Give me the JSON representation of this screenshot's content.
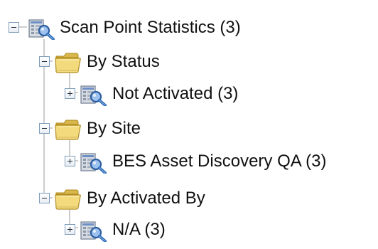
{
  "tree": {
    "root": {
      "label": "Scan Point Statistics (3)",
      "icon": "report-magnifier-icon",
      "expanded": true
    },
    "groups": [
      {
        "label": "By Status",
        "icon": "folder-icon",
        "expanded": true,
        "child": {
          "label": "Not Activated (3)",
          "icon": "report-magnifier-icon",
          "expanded": false
        }
      },
      {
        "label": "By Site",
        "icon": "folder-icon",
        "expanded": true,
        "child": {
          "label": "BES Asset Discovery QA (3)",
          "icon": "report-magnifier-icon",
          "expanded": false
        }
      },
      {
        "label": "By Activated By",
        "icon": "folder-icon",
        "expanded": true,
        "child": {
          "label": "N/A (3)",
          "icon": "report-magnifier-icon",
          "expanded": false
        }
      }
    ]
  },
  "colors": {
    "tree_line": "#9c9c9c",
    "toggle_border": "#7f9db9",
    "folder_front": "#f3da7d",
    "folder_back": "#d8b74c",
    "report_blue": "#5c87c4",
    "report_gray": "#d7dce3"
  }
}
